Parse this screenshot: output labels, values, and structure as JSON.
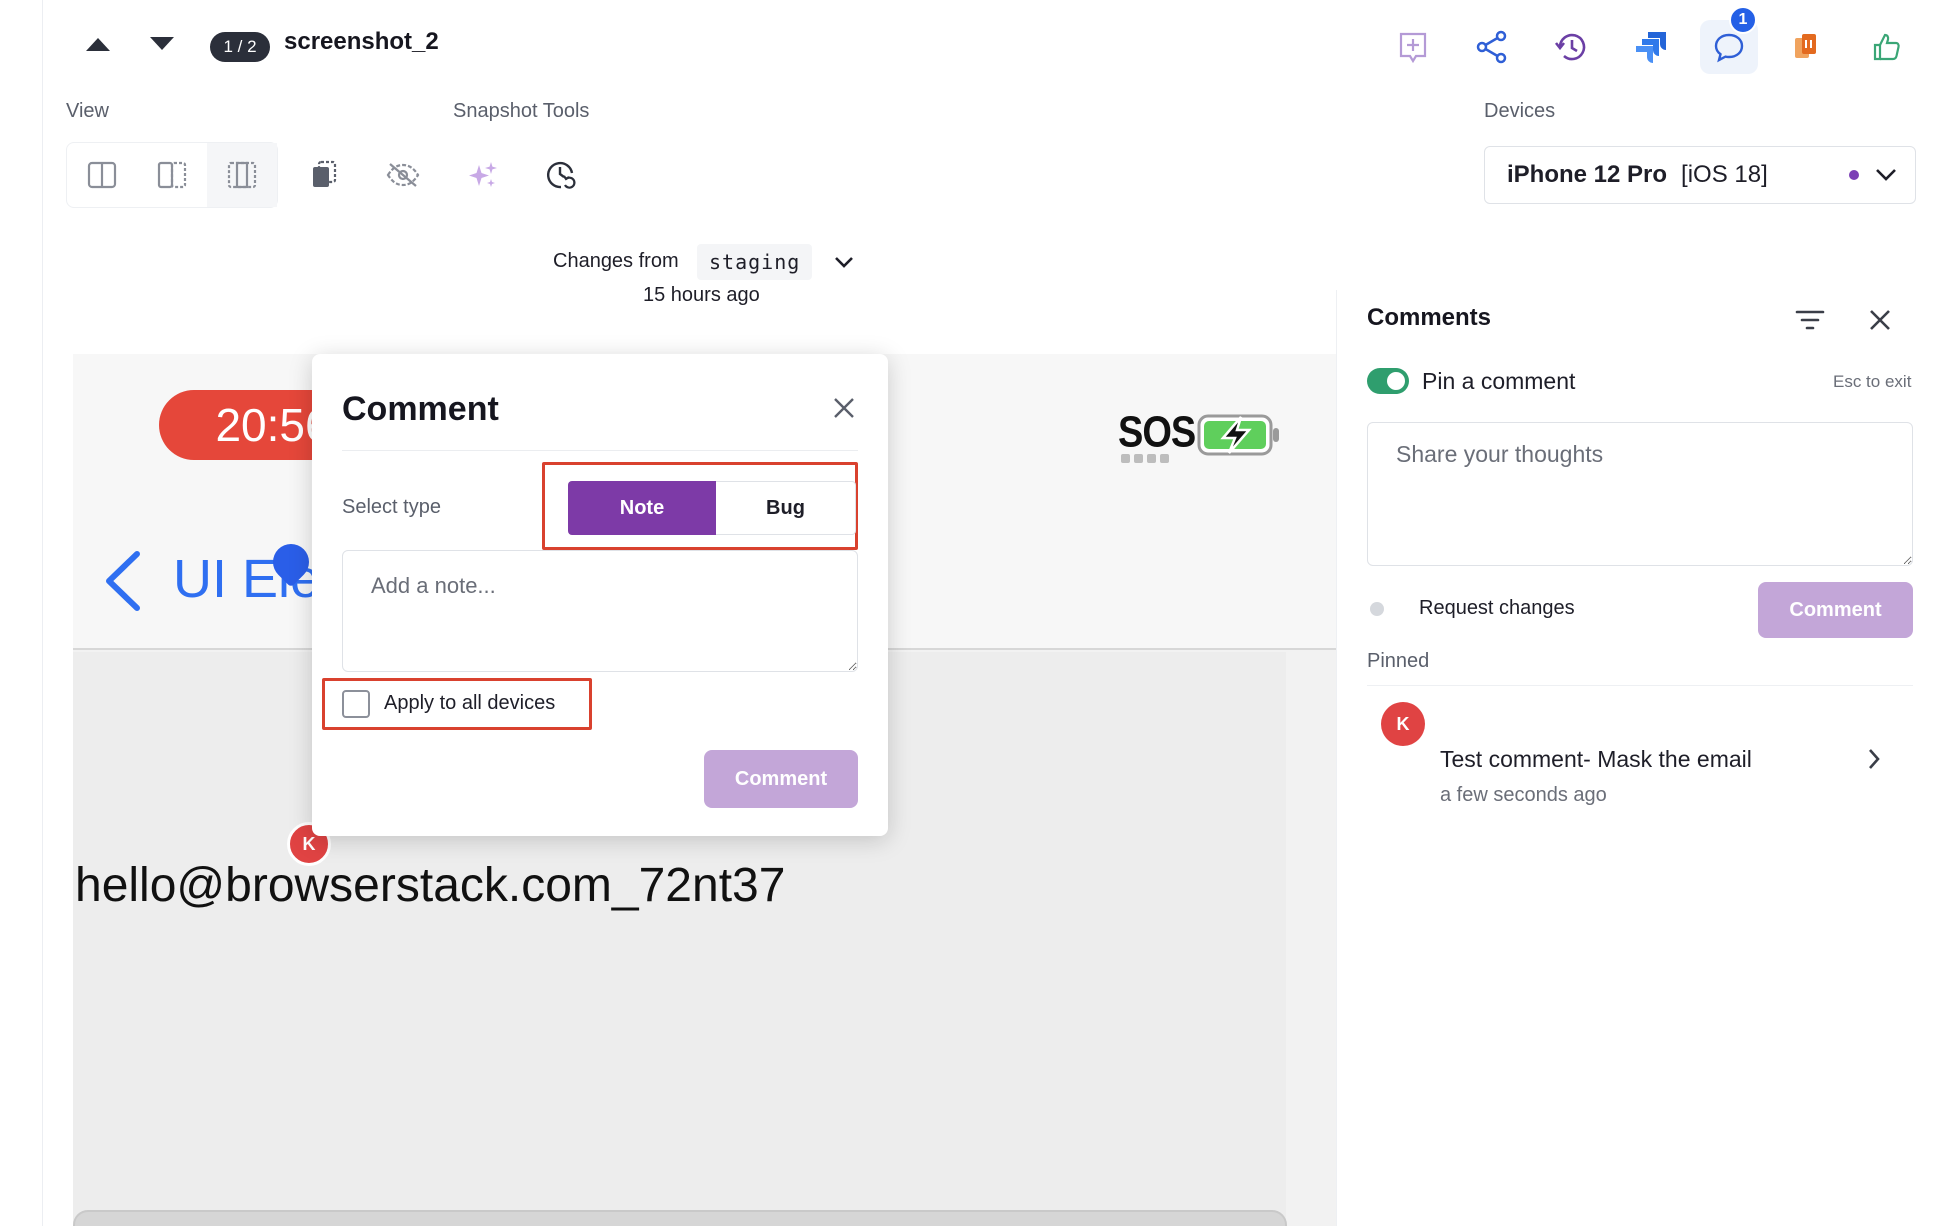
{
  "header": {
    "pager": "1 / 2",
    "title": "screenshot_2",
    "comment_badge": "1"
  },
  "toolbar": {
    "view_label": "View",
    "snapshot_tools_label": "Snapshot Tools",
    "devices_label": "Devices"
  },
  "device": {
    "name": "iPhone 12 Pro",
    "os": "[iOS 18]"
  },
  "changes": {
    "prefix": "Changes from",
    "branch": "staging",
    "time": "15 hours ago"
  },
  "preview": {
    "clock": "20:56",
    "sos": "SOS",
    "nav_title": "UI Ele",
    "email": "hello@browserstack.com_72nt37",
    "pin_initial": "K"
  },
  "modal": {
    "title": "Comment",
    "select_type_label": "Select type",
    "type_options": [
      "Note",
      "Bug"
    ],
    "selected_type": "Note",
    "note_placeholder": "Add a note...",
    "apply_all_label": "Apply to all devices",
    "apply_all_checked": false,
    "submit_label": "Comment"
  },
  "comments_panel": {
    "title": "Comments",
    "pin_label": "Pin a comment",
    "pin_enabled": true,
    "esc_hint": "Esc to exit",
    "input_placeholder": "Share your thoughts",
    "request_changes_label": "Request changes",
    "submit_label": "Comment",
    "pinned_label": "Pinned",
    "pinned": [
      {
        "initial": "K",
        "text": "Test comment- Mask the email",
        "time": "a few seconds ago"
      }
    ]
  },
  "colors": {
    "accent_purple": "#7d3aa7",
    "disabled_purple": "#c3a6d8",
    "highlight_red": "#d9412e",
    "toggle_green": "#2f9e6e",
    "avatar_red": "#e04343",
    "link_blue": "#2f6ff1"
  },
  "icons": {
    "nav": [
      "triangle-up-icon",
      "triangle-down-icon"
    ],
    "top_actions": [
      "add-annotation-icon",
      "share-icon",
      "history-icon",
      "jira-icon",
      "comment-icon",
      "stack-icon",
      "thumbs-up-icon"
    ],
    "views": [
      "split-view-icon",
      "side-by-side-icon",
      "overlay-view-icon"
    ],
    "snapshot_tools": [
      "copy-icon",
      "hide-eye-icon",
      "sparkles-icon",
      "clock-refresh-icon"
    ]
  }
}
